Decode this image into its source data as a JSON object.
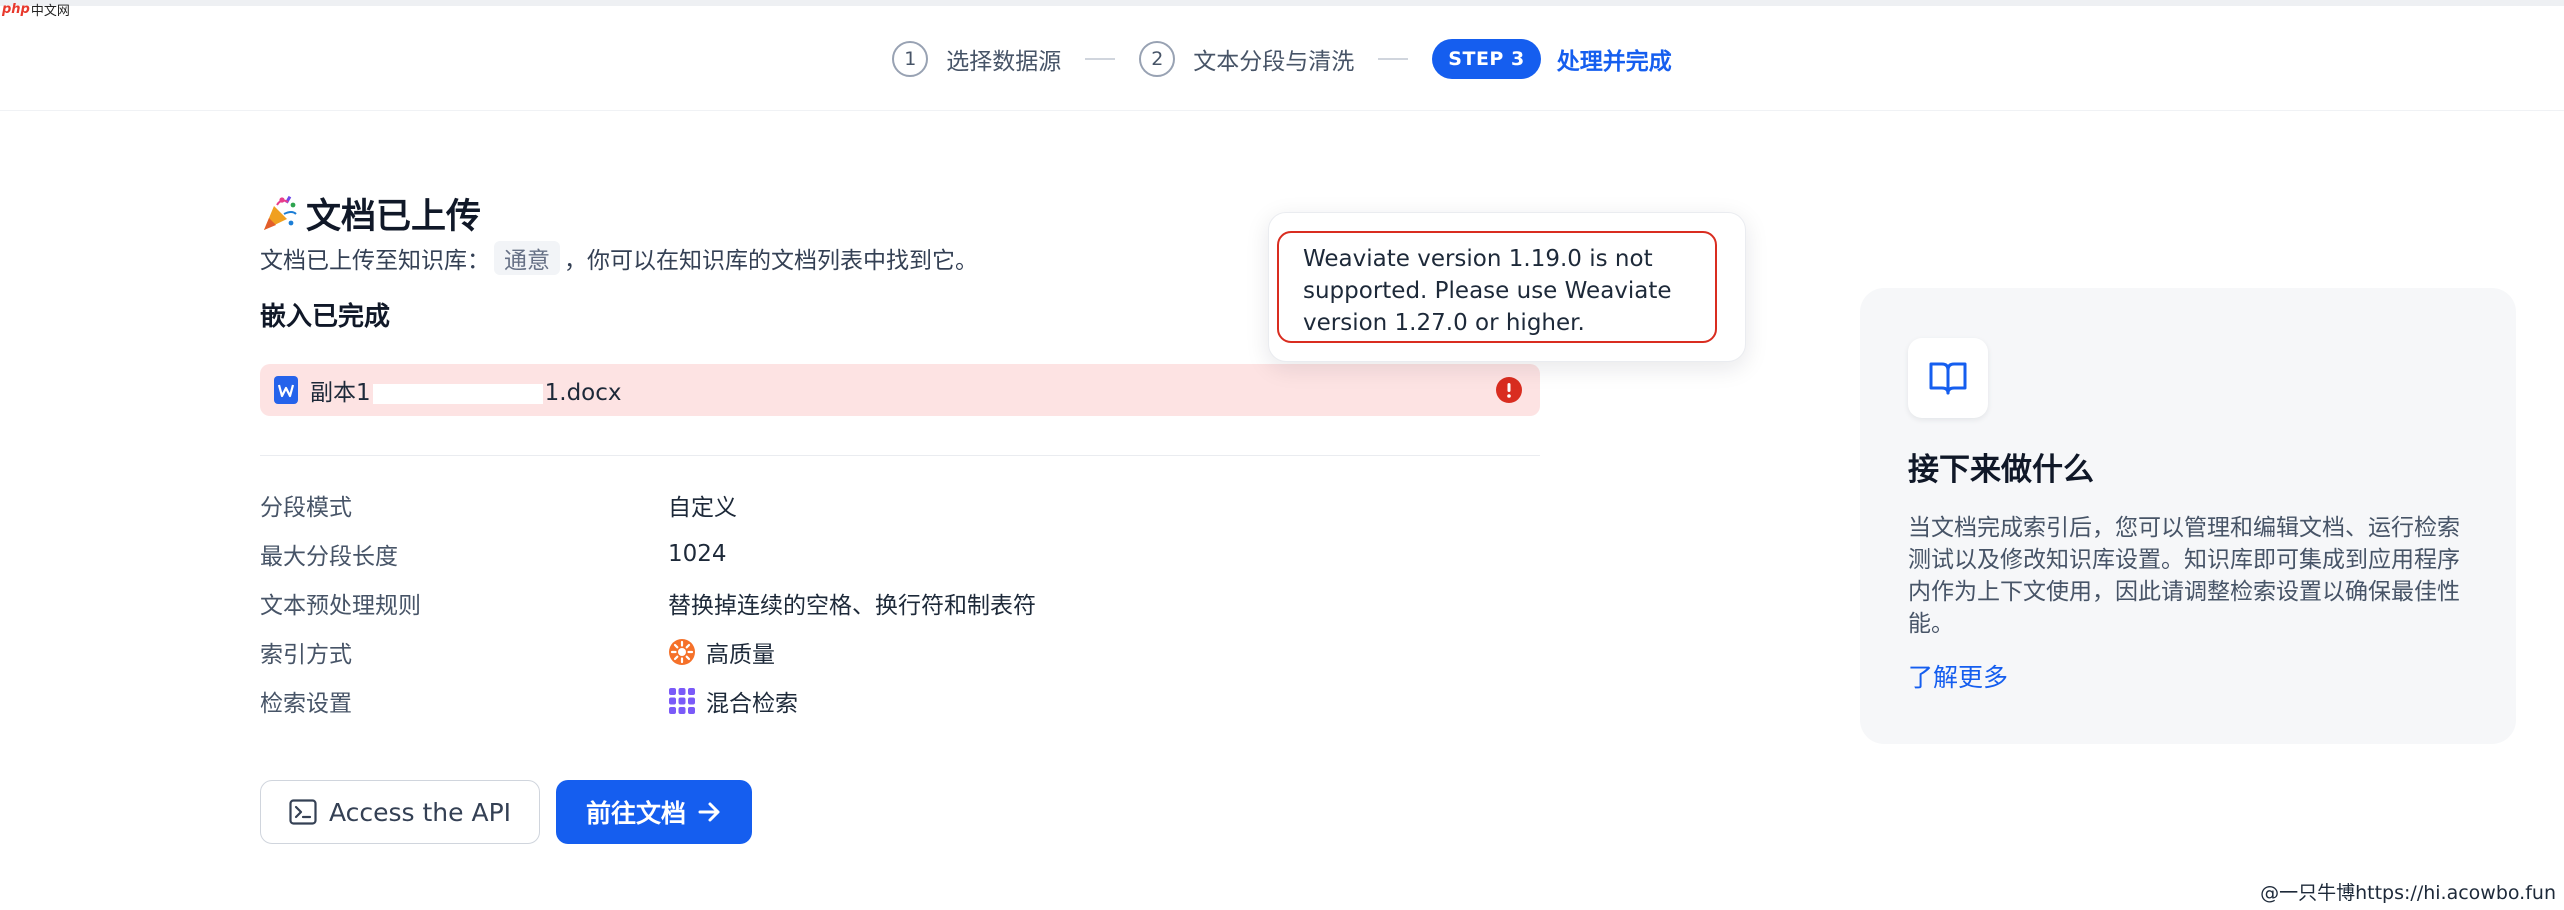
{
  "brand": {
    "logo_mark": "php",
    "logo_text": "中文网"
  },
  "stepper": {
    "step1": {
      "number": "1",
      "label": "选择数据源"
    },
    "step2": {
      "number": "2",
      "label": "文本分段与清洗"
    },
    "step3": {
      "badge": "STEP 3",
      "label": "处理并完成"
    }
  },
  "main": {
    "title": "文档已上传",
    "subtitle_prefix": "文档已上传至知识库：",
    "kb_name": "通意",
    "subtitle_suffix": "，你可以在知识库的文档列表中找到它。",
    "embedding_heading": "嵌入已完成",
    "file": {
      "name_prefix": "副本1",
      "name_suffix": "1.docx"
    }
  },
  "props": [
    {
      "label": "分段模式",
      "value": "自定义"
    },
    {
      "label": "最大分段长度",
      "value": "1024"
    },
    {
      "label": "文本预处理规则",
      "value": "替换掉连续的空格、换行符和制表符"
    },
    {
      "label": "索引方式",
      "value": "高质量",
      "icon": "high-quality-icon"
    },
    {
      "label": "检索设置",
      "value": "混合检索",
      "icon": "hybrid-search-icon"
    }
  ],
  "actions": {
    "api_label": "Access the API",
    "go_label": "前往文档"
  },
  "toast": {
    "message": "Weaviate version 1.19.0 is not supported. Please use Weaviate version 1.27.0 or higher."
  },
  "side": {
    "title": "接下来做什么",
    "description": "当文档完成索引后，您可以管理和编辑文档、运行检索测试以及修改知识库设置。知识库即可集成到应用程序内作为上下文使用，因此请调整检索设置以确保最佳性能。",
    "link": "了解更多"
  },
  "watermark": "@一只牛博https://hi.acowbo.fun",
  "colors": {
    "primary": "#155eef",
    "error": "#d92d20",
    "error_bg": "#fde3e3",
    "card_bg": "#f6f7f9"
  }
}
